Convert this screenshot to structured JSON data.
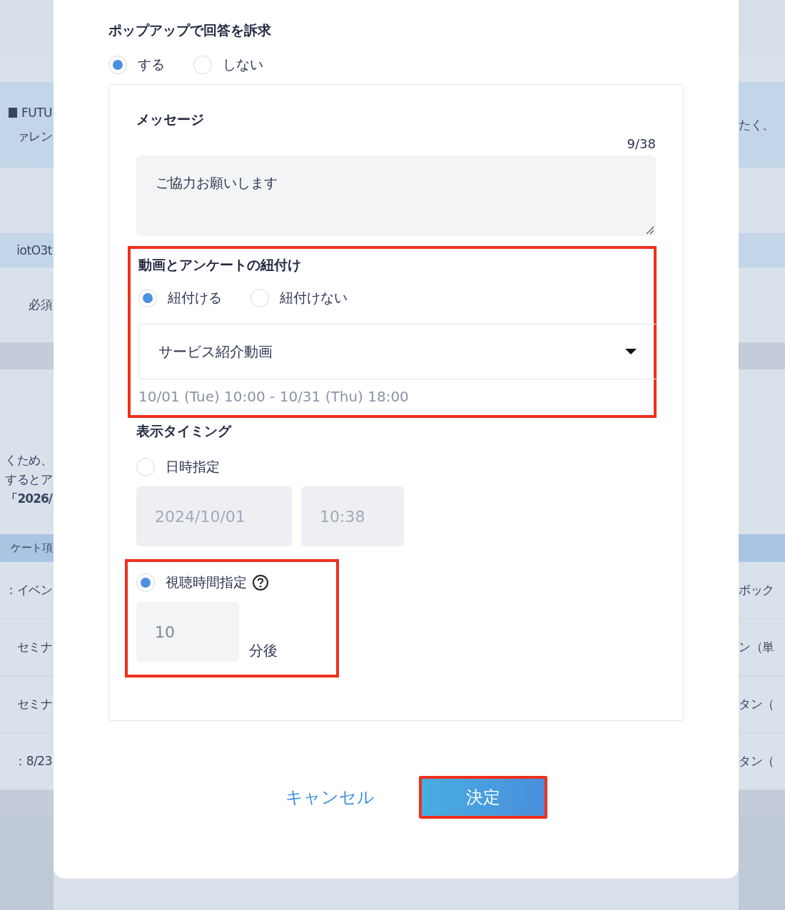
{
  "background": {
    "rows": [
      {
        "kind": "top",
        "left": [],
        "right": []
      },
      {
        "kind": "band",
        "left": [
          {
            "kind": "labeled",
            "text": "FUTU"
          },
          {
            "kind": "plain",
            "text": "ァレン"
          }
        ],
        "right": [
          "たく、"
        ]
      },
      {
        "kind": "gap",
        "left": [],
        "right": []
      },
      {
        "kind": "band-sm",
        "left": [
          {
            "kind": "plain",
            "text": "iotO3t"
          }
        ],
        "right": []
      },
      {
        "kind": "plain",
        "left": [
          {
            "kind": "plain",
            "text": "必須"
          }
        ],
        "right": []
      },
      {
        "kind": "divider",
        "left": [],
        "right": []
      },
      {
        "kind": "block",
        "left": [
          {
            "kind": "plain",
            "text": "くため、"
          },
          {
            "kind": "plain",
            "text": "するとア"
          },
          {
            "kind": "bold",
            "text": "「2026/"
          }
        ],
        "right": []
      },
      {
        "kind": "header",
        "left": [
          {
            "kind": "plain",
            "text": "ケート項"
          }
        ],
        "right": []
      },
      {
        "kind": "row",
        "left": [
          {
            "kind": "plain",
            "text": "：イベン"
          }
        ],
        "right": [
          "ボック"
        ]
      },
      {
        "kind": "row",
        "left": [
          {
            "kind": "plain",
            "text": "セミナ"
          }
        ],
        "right": [
          "ン（単"
        ]
      },
      {
        "kind": "row",
        "left": [
          {
            "kind": "plain",
            "text": "セミナ"
          }
        ],
        "right": [
          "タン（"
        ]
      },
      {
        "kind": "row",
        "left": [
          {
            "kind": "plain",
            "text": "：8/23"
          }
        ],
        "right": [
          "タン（"
        ]
      },
      {
        "kind": "divider",
        "left": [],
        "right": []
      },
      {
        "kind": "bottom",
        "left": [],
        "right": []
      }
    ]
  },
  "modal": {
    "title": "ポップアップで回答を訴求",
    "options": [
      {
        "label": "する",
        "selected": true
      },
      {
        "label": "しない",
        "selected": false
      }
    ],
    "message": {
      "label": "メッセージ",
      "counter": "9/38",
      "value": "ご協力お願いします"
    },
    "link": {
      "highlighted": true,
      "title": "動画とアンケートの紐付け",
      "options": [
        {
          "label": "紐付ける",
          "selected": true
        },
        {
          "label": "紐付けない",
          "selected": false
        }
      ],
      "video": "サービス紹介動画",
      "period": "10/01 (Tue) 10:00 - 10/31 (Thu) 18:00"
    },
    "timing": {
      "title": "表示タイミング",
      "options": [
        {
          "kind": "datetime",
          "label": "日時指定",
          "selected": false,
          "disabled": true,
          "highlighted": false,
          "date": "2024/10/01",
          "time": "10:38"
        },
        {
          "kind": "duration",
          "label": "視聴時間指定",
          "selected": true,
          "disabled": false,
          "highlighted": true,
          "value": "10",
          "unit": "分後"
        }
      ]
    },
    "buttons": [
      {
        "kind": "cancel",
        "label": "キャンセル",
        "highlighted": false
      },
      {
        "kind": "confirm",
        "label": "決定",
        "highlighted": true
      }
    ]
  }
}
